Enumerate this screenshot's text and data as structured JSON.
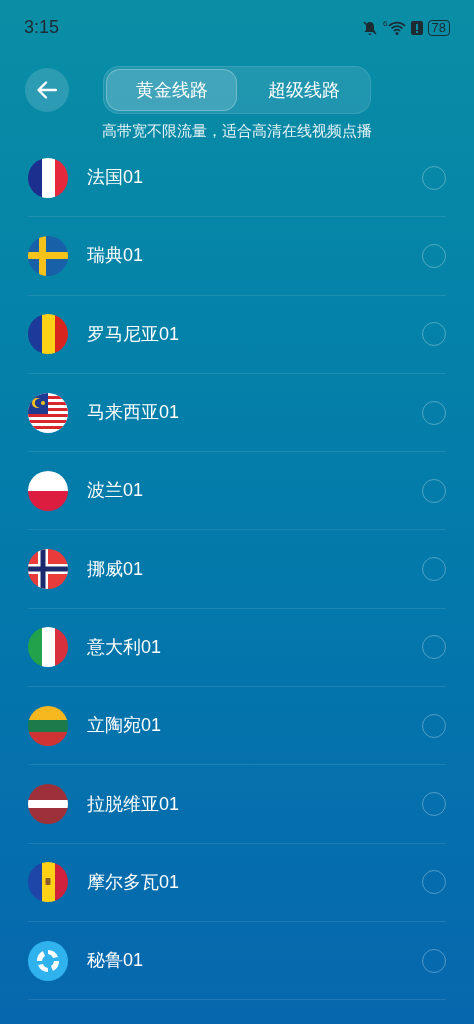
{
  "status_bar": {
    "time": "3:15",
    "battery": "78",
    "wifi_badge": "6"
  },
  "tabs": [
    {
      "label": "黄金线路",
      "selected": true
    },
    {
      "label": "超级线路",
      "selected": false
    }
  ],
  "subtitle": "高带宽不限流量，适合高清在线视频点播",
  "servers": [
    {
      "name": "法国01",
      "kind": "france",
      "selected": false
    },
    {
      "name": "瑞典01",
      "kind": "sweden",
      "selected": false
    },
    {
      "name": "罗马尼亚01",
      "kind": "romania",
      "selected": false
    },
    {
      "name": "马来西亚01",
      "kind": "malaysia",
      "selected": false
    },
    {
      "name": "波兰01",
      "kind": "poland",
      "selected": false
    },
    {
      "name": "挪威01",
      "kind": "norway",
      "selected": false
    },
    {
      "name": "意大利01",
      "kind": "italy",
      "selected": false
    },
    {
      "name": "立陶宛01",
      "kind": "lithuania",
      "selected": false
    },
    {
      "name": "拉脱维亚01",
      "kind": "latvia",
      "selected": false
    },
    {
      "name": "摩尔多瓦01",
      "kind": "moldova",
      "selected": false
    },
    {
      "name": "秘鲁01",
      "kind": "logo",
      "selected": false
    }
  ]
}
